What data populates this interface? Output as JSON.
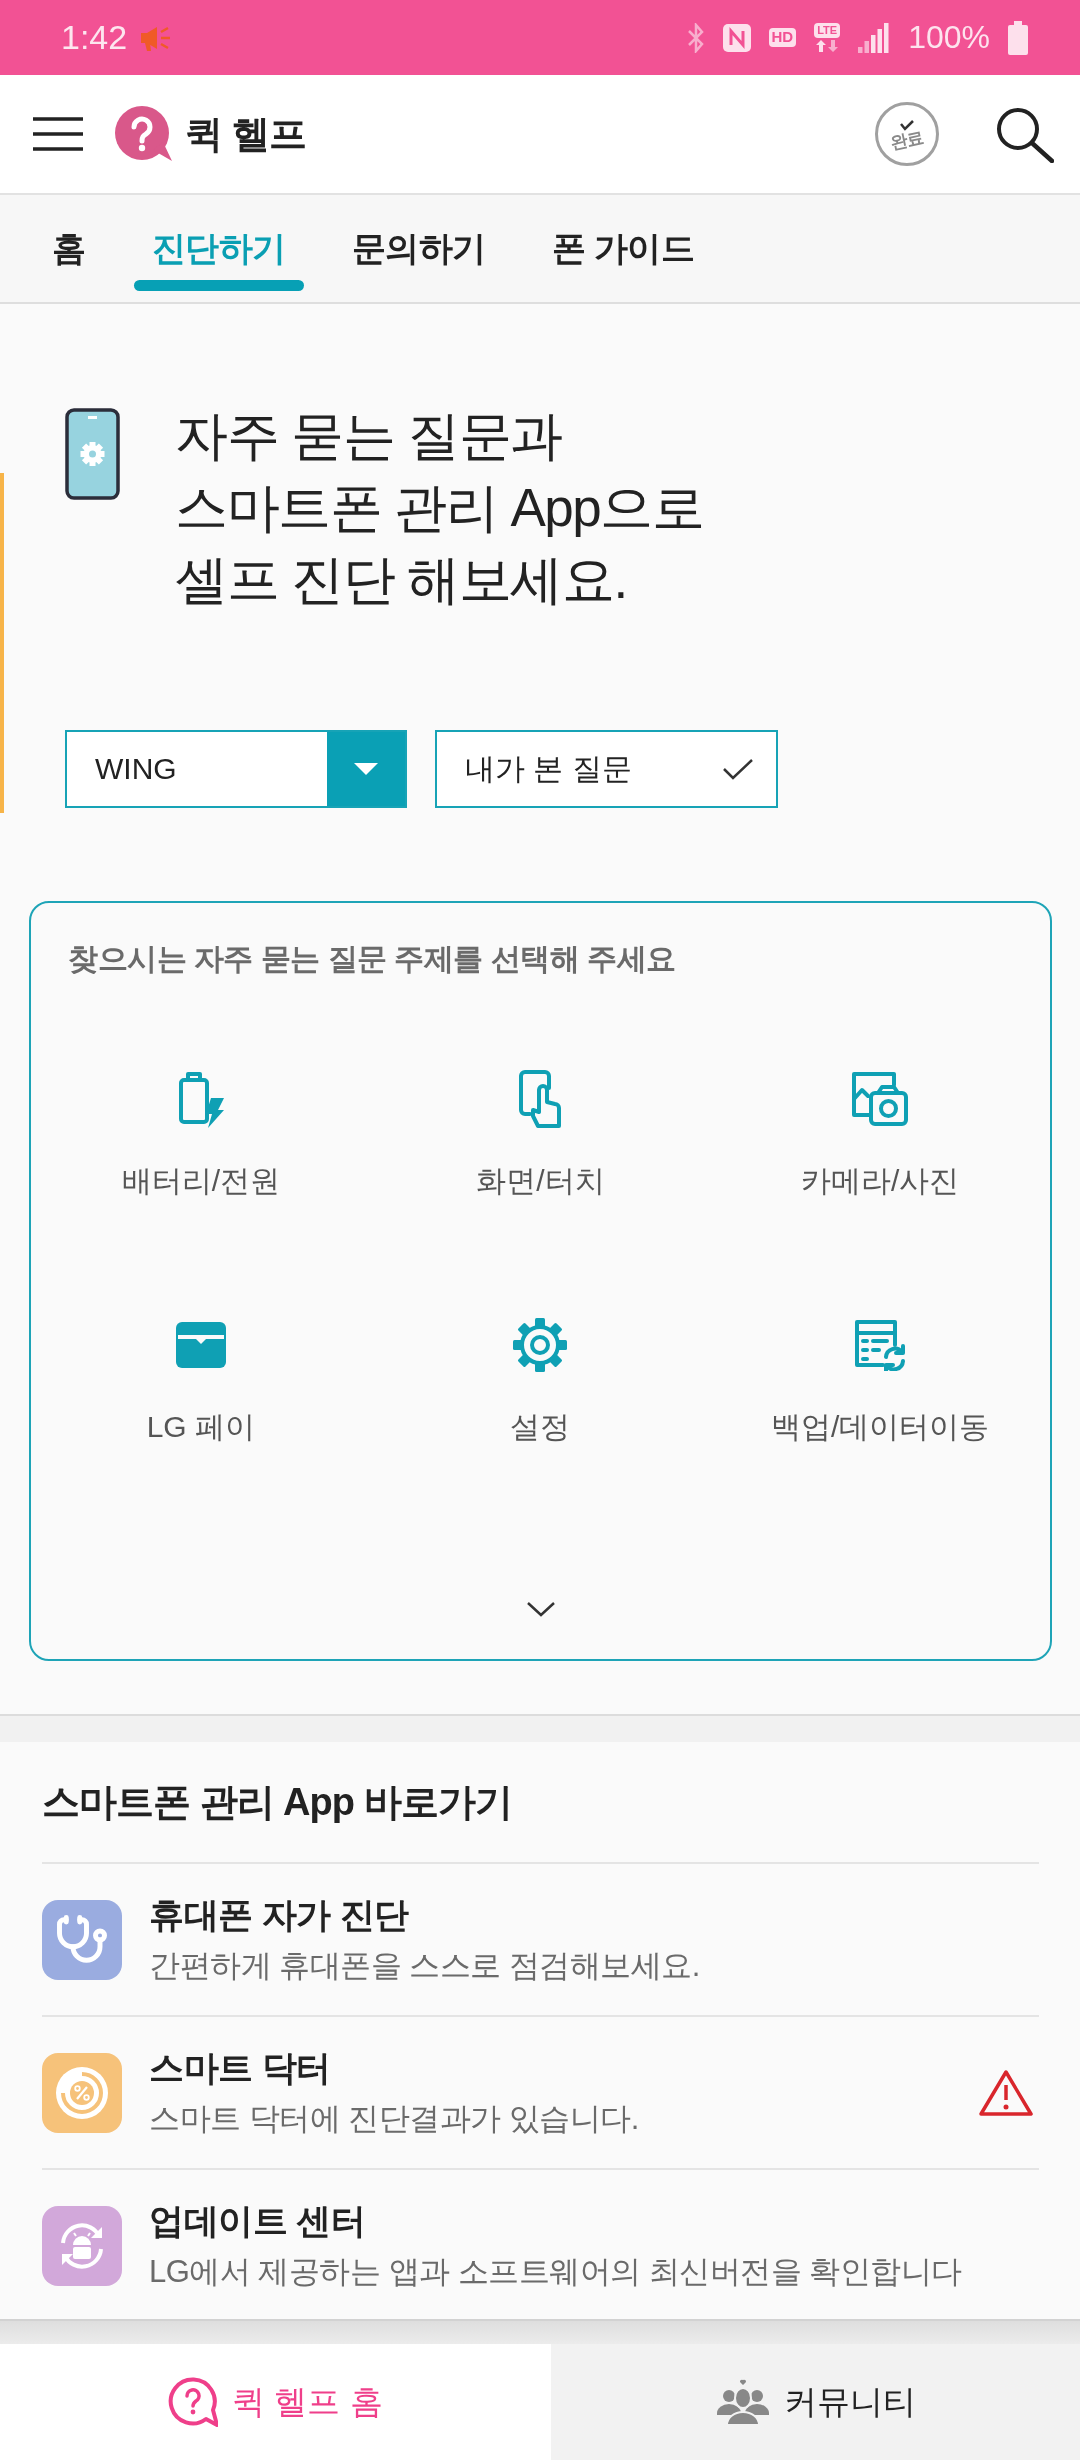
{
  "status_bar": {
    "time": "1:42",
    "hd": "HD",
    "lte": "LTE",
    "battery": "100%"
  },
  "header": {
    "title": "퀵 헬프",
    "stamp": "완료"
  },
  "tabs": [
    {
      "label": "홈",
      "selected": false
    },
    {
      "label": "진단하기",
      "selected": true
    },
    {
      "label": "문의하기",
      "selected": false
    },
    {
      "label": "폰 가이드",
      "selected": false
    }
  ],
  "hero": {
    "title": "자주 묻는 질문과\n스마트폰 관리 App으로\n셀프 진단 해보세요."
  },
  "filters": {
    "model": "WING",
    "history": "내가 본 질문"
  },
  "topic_card": {
    "heading": "찾으시는 자주 묻는 질문 주제를 선택해 주세요",
    "expanded": false,
    "topics": [
      {
        "kind": "battery",
        "label": "배터리/전원"
      },
      {
        "kind": "touch",
        "label": "화면/터치"
      },
      {
        "kind": "camera",
        "label": "카메라/사진"
      },
      {
        "kind": "pay",
        "label": "LG 페이"
      },
      {
        "kind": "settings",
        "label": "설정"
      },
      {
        "kind": "backup",
        "label": "백업/데이터이동"
      }
    ]
  },
  "apps": {
    "title": "스마트폰 관리 App 바로가기",
    "items": [
      {
        "kind": "stethoscope",
        "color": "#9aace0",
        "title": "휴대폰 자가 진단",
        "subtitle": "간편하게 휴대폰을 스스로 점검해보세요.",
        "warning": false
      },
      {
        "kind": "gauge",
        "color": "#f6c27a",
        "title": "스마트 닥터",
        "subtitle": "스마트 닥터에 진단결과가 있습니다.",
        "warning": true
      },
      {
        "kind": "update",
        "color": "#d2a8da",
        "title": "업데이트 센터",
        "subtitle": "LG에서 제공하는 앱과 소프트웨어의 최신버전을 확인합니다",
        "warning": false
      }
    ]
  },
  "bottom_nav": [
    {
      "kind": "help",
      "label": "퀵 헬프 홈",
      "selected": true
    },
    {
      "kind": "community",
      "label": "커뮤니티",
      "selected": false
    }
  ]
}
